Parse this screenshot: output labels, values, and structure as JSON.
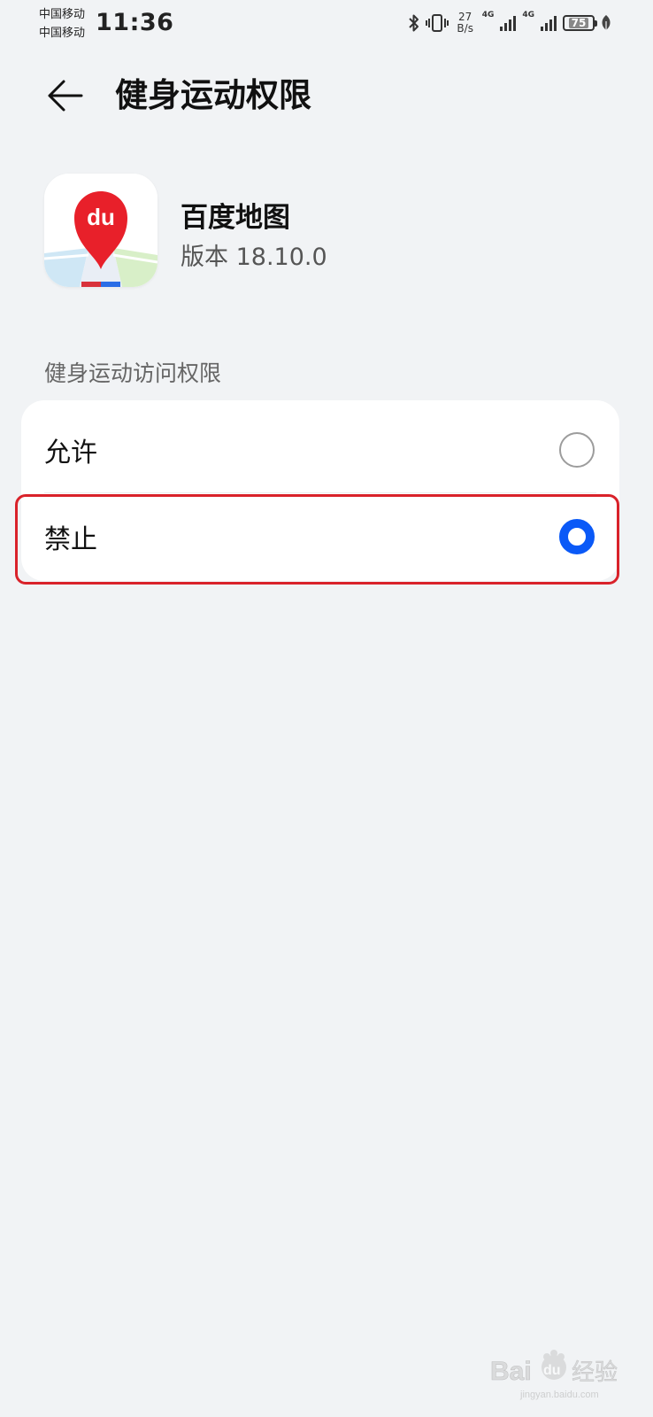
{
  "status_bar": {
    "carrier_1": "中国移动",
    "carrier_2": "中国移动",
    "time": "11:36",
    "net_speed_value": "27",
    "net_speed_unit": "B/s",
    "network_1": "4G",
    "network_2": "4G",
    "battery": "75"
  },
  "header": {
    "title": "健身运动权限"
  },
  "app": {
    "name": "百度地图",
    "version": "版本 18.10.0",
    "icon_text": "du"
  },
  "permission": {
    "section_label": "健身运动访问权限",
    "options": [
      {
        "label": "允许",
        "selected": false
      },
      {
        "label": "禁止",
        "selected": true
      }
    ]
  },
  "watermark": {
    "text": "Bai du 经验",
    "url": "jingyan.baidu.com"
  },
  "colors": {
    "accent": "#0a59f7",
    "highlight": "#d9222a",
    "background": "#f1f3f5",
    "card": "#ffffff",
    "map_pin": "#e8202a"
  }
}
